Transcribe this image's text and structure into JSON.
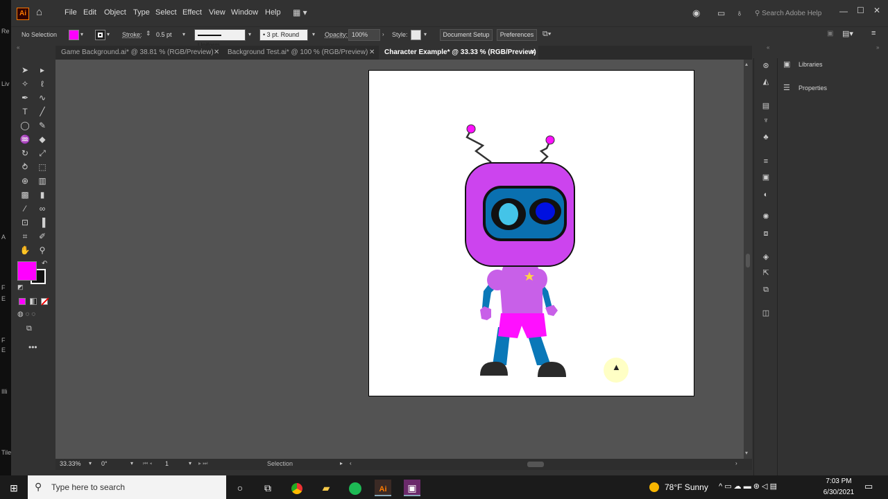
{
  "app": {
    "logo": "Ai",
    "menu": [
      "File",
      "Edit",
      "Object",
      "Type",
      "Select",
      "Effect",
      "View",
      "Window",
      "Help"
    ],
    "search_placeholder": "Search Adobe Help"
  },
  "control_bar": {
    "selection": "No Selection",
    "stroke_label": "Stroke:",
    "stroke_value": "0.5 pt",
    "profile": "Uniform",
    "brush": "3 pt. Round",
    "opacity_label": "Opacity:",
    "opacity_value": "100%",
    "style_label": "Style:",
    "document_setup": "Document Setup",
    "preferences": "Preferences",
    "fill_color": "#ff00ff"
  },
  "tabs": [
    {
      "label": "Game Background.ai* @ 38.81 % (RGB/Preview)",
      "close": "✕"
    },
    {
      "label": "Background Test.ai* @ 100 % (RGB/Preview)",
      "close": "✕"
    },
    {
      "label": "Character Example* @ 33.33 % (RGB/Preview)",
      "close": "✕"
    }
  ],
  "status_bar": {
    "zoom": "33.33%",
    "rotation": "0°",
    "artboard": "1",
    "tool": "Selection"
  },
  "panels": {
    "libraries": "Libraries",
    "properties": "Properties"
  },
  "background_window": {
    "labels": [
      "Re",
      "Liv",
      "A",
      "F",
      "E",
      "F",
      "E",
      "Illi",
      "Tile"
    ]
  },
  "taskbar": {
    "search_placeholder": "Type here to search",
    "weather": "78°F  Sunny",
    "time": "7:03 PM",
    "date": "6/30/2021"
  },
  "colors": {
    "accent": "#ff7c00",
    "head": "#cc44ee",
    "screen": "#0a70b0",
    "eye_left": "#44c4e8",
    "eye_right": "#0010e0",
    "body": "#c860e8",
    "shorts": "#ff10ff",
    "legs": "#0a78b8",
    "shoes": "#2a2a2a",
    "antenna_tip": "#ff10ff"
  }
}
